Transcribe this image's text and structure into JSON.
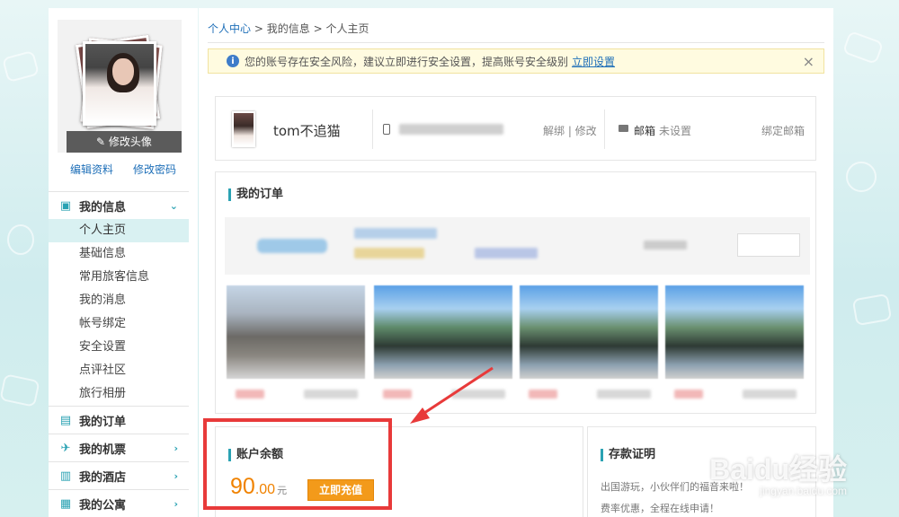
{
  "left": {
    "edit_avatar": "修改头像",
    "edit_profile": "编辑资料",
    "change_password": "修改密码",
    "menu": {
      "my_info": "我的信息",
      "my_info_items": [
        "个人主页",
        "基础信息",
        "常用旅客信息",
        "我的消息",
        "帐号绑定",
        "安全设置",
        "点评社区",
        "旅行相册"
      ],
      "my_orders": "我的订单",
      "my_flights": "我的机票",
      "my_hotels": "我的酒店",
      "my_apartments": "我的公寓"
    }
  },
  "main": {
    "breadcrumb": {
      "home": "个人中心",
      "sep1": ">",
      "level2": "我的信息",
      "sep2": ">",
      "current": "个人主页"
    },
    "alert": {
      "text": "您的账号存在安全风险，建议立即进行安全设置，提高账号安全级别",
      "link": "立即设置",
      "close": "×"
    },
    "user": {
      "name": "tom不追猫",
      "phone_actions": "解绑 | 修改",
      "mail_label": "邮箱",
      "mail_status": "未设置",
      "mail_bind": "绑定邮箱"
    },
    "orders_title": "我的订单",
    "balance": {
      "title": "账户余额",
      "amount_int": "90",
      "amount_dec": ".00",
      "unit": "元",
      "button": "立即充值"
    },
    "deposit": {
      "title": "存款证明",
      "line1": "出国游玩，小伙伴们的福音来啦！",
      "line2": "费率优惠，全程在线申请！"
    }
  },
  "watermark": {
    "brand": "Baidu经验",
    "url": "jingyan.baidu.com"
  },
  "colors": {
    "accent": "#2aa2b3",
    "link": "#1e6fb8",
    "orange": "#f08200",
    "highlight": "#e83a3a"
  }
}
